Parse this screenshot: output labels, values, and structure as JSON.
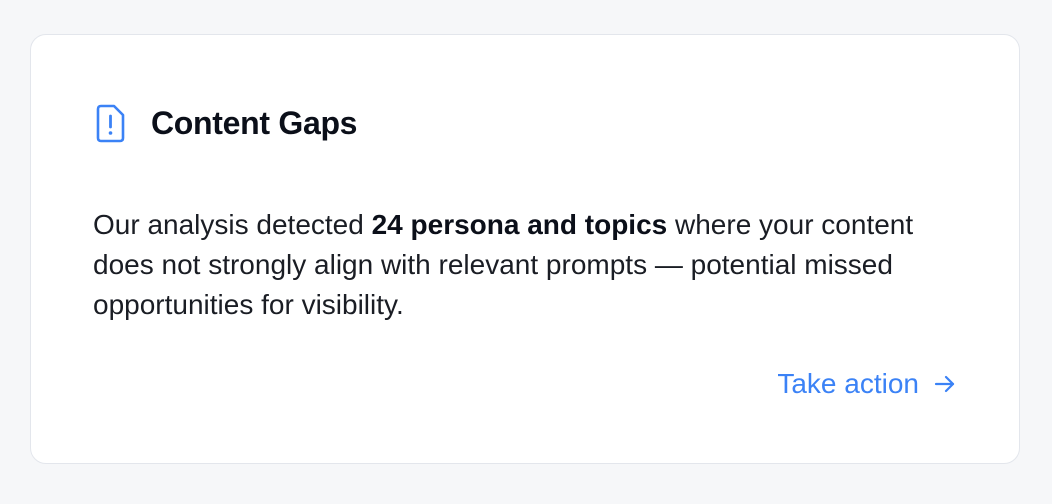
{
  "card": {
    "title": "Content Gaps",
    "icon": "file-alert-icon",
    "accent_color": "#3b82f6",
    "description": {
      "before": "Our analysis detected ",
      "highlight": "24 persona and topics",
      "after": " where your content does not strongly align with relevant prompts — potential missed opportunities for visibility."
    },
    "action_label": "Take action",
    "action_icon": "arrow-right-icon"
  }
}
